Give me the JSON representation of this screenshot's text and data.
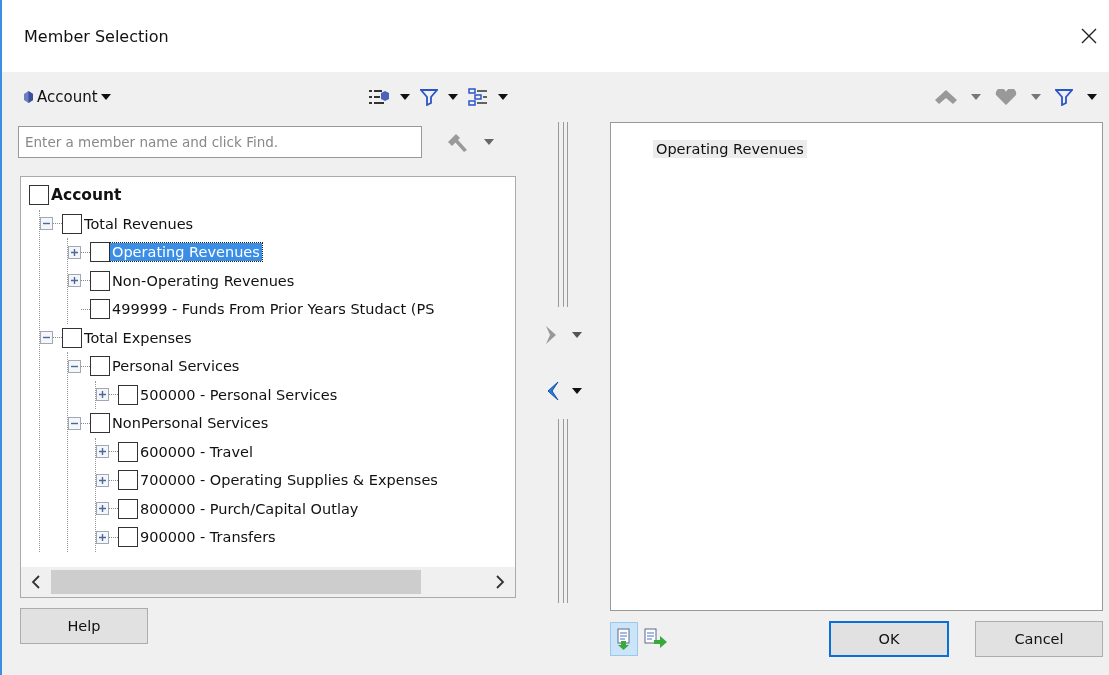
{
  "window": {
    "title": "Member Selection"
  },
  "dimension": {
    "label": "Account"
  },
  "search": {
    "placeholder": "Enter a member name and click Find."
  },
  "tree": {
    "root": {
      "label": "Account",
      "checked": false,
      "selected": false,
      "children": [
        {
          "label": "Total Revenues",
          "kind": "expandable",
          "expanded": true,
          "checked": false,
          "selected": false,
          "children": [
            {
              "label": "Operating Revenues",
              "kind": "expandable",
              "expanded": false,
              "checked": false,
              "selected": true
            },
            {
              "label": "Non-Operating Revenues",
              "kind": "expandable",
              "expanded": false,
              "checked": false,
              "selected": false
            },
            {
              "label": "499999 - Funds From Prior Years Studact (PS",
              "kind": "leaf",
              "checked": false,
              "selected": false
            }
          ]
        },
        {
          "label": "Total Expenses",
          "kind": "expandable",
          "expanded": true,
          "checked": false,
          "selected": false,
          "children": [
            {
              "label": "Personal Services",
              "kind": "expandable",
              "expanded": true,
              "checked": false,
              "selected": false,
              "children": [
                {
                  "label": "500000 - Personal Services",
                  "kind": "expandable",
                  "expanded": false,
                  "checked": false,
                  "selected": false
                }
              ]
            },
            {
              "label": "NonPersonal Services",
              "kind": "expandable",
              "expanded": true,
              "checked": false,
              "selected": false,
              "children": [
                {
                  "label": "600000 - Travel",
                  "kind": "expandable",
                  "expanded": false,
                  "checked": false,
                  "selected": false
                },
                {
                  "label": "700000 - Operating Supplies & Expenses",
                  "kind": "expandable",
                  "expanded": false,
                  "checked": false,
                  "selected": false
                },
                {
                  "label": "800000 - Purch/Capital Outlay",
                  "kind": "expandable",
                  "expanded": false,
                  "checked": false,
                  "selected": false
                },
                {
                  "label": "900000 - Transfers",
                  "kind": "expandable",
                  "expanded": false,
                  "checked": false,
                  "selected": false
                }
              ]
            }
          ]
        }
      ]
    }
  },
  "selection": {
    "items": [
      {
        "label": "Operating Revenues"
      }
    ]
  },
  "view_buttons": [
    {
      "selected": true
    },
    {
      "selected": false
    }
  ],
  "buttons": {
    "help": "Help",
    "ok": "OK",
    "cancel": "Cancel"
  }
}
